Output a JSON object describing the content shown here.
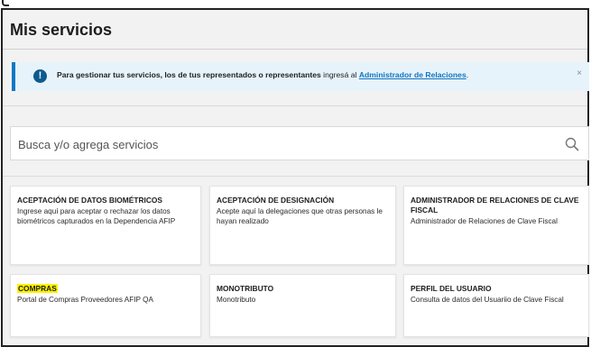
{
  "page": {
    "title": "Mis servicios"
  },
  "alert": {
    "text_bold": "Para gestionar tus servicios, los de tus representados o representantes",
    "text_mid": " ingresá al ",
    "link": "Administrador de Relaciones",
    "text_end": ".",
    "close": "×"
  },
  "search": {
    "placeholder": "Busca y/o agrega servicios"
  },
  "services": [
    {
      "title": "ACEPTACIÓN DE DATOS BIOMÉTRICOS",
      "description": "Ingrese aquí para aceptar o rechazar los datos biométricos capturados en la Dependencia AFIP"
    },
    {
      "title": "ACEPTACIÓN DE DESIGNACIÓN",
      "description": "Acepte aquí la delegaciones que otras personas le hayan realizado"
    },
    {
      "title": "ADMINISTRADOR DE RELACIONES DE CLAVE FISCAL",
      "description": "Administrador de Relaciones de Clave Fiscal"
    },
    {
      "title": "COMPRAS",
      "description": "Portal de Compras Proveedores AFIP QA",
      "highlighted": true
    },
    {
      "title": "MONOTRIBUTO",
      "description": "Monotributo"
    },
    {
      "title": "PERFIL DEL USUARIO",
      "description": "Consulta de datos del Usuariio de Clave Fiscal"
    }
  ],
  "colors": {
    "accent": "#0d79c4",
    "link": "#1075c0",
    "highlight": "#fff200",
    "panel_bg": "#f2f2f2"
  },
  "icons": {
    "alert": "exclamation-circle-icon",
    "search": "search-icon",
    "close": "close-icon"
  }
}
